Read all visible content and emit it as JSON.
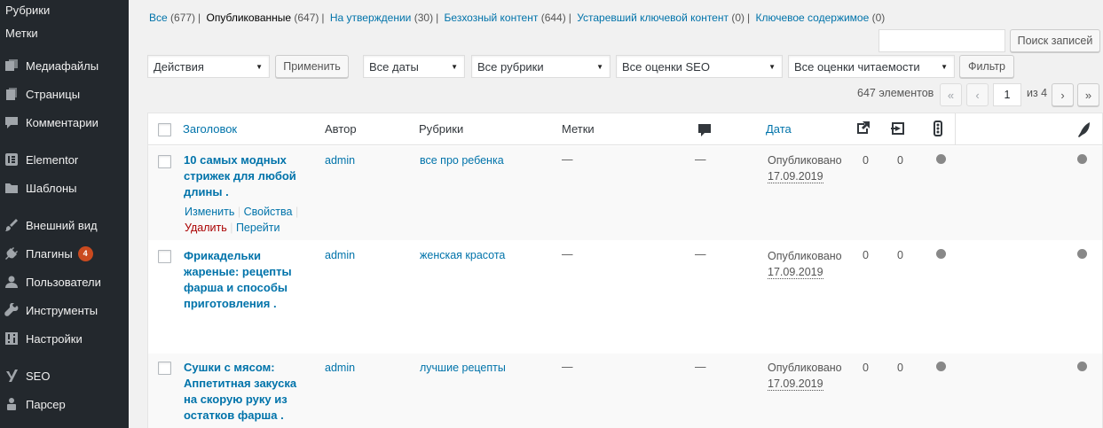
{
  "sidebar": {
    "sub_items": [
      "Рубрики",
      "Метки"
    ],
    "items": [
      {
        "label": "Медиафайлы",
        "icon": "media-icon"
      },
      {
        "label": "Страницы",
        "icon": "pages-icon"
      },
      {
        "label": "Комментарии",
        "icon": "comments-icon"
      },
      {
        "label": "Elementor",
        "icon": "elementor-icon"
      },
      {
        "label": "Шаблоны",
        "icon": "folder-icon"
      },
      {
        "label": "Внешний вид",
        "icon": "appearance-icon"
      },
      {
        "label": "Плагины",
        "icon": "plugins-icon",
        "badge": "4"
      },
      {
        "label": "Пользователи",
        "icon": "users-icon"
      },
      {
        "label": "Инструменты",
        "icon": "tools-icon"
      },
      {
        "label": "Настройки",
        "icon": "settings-icon"
      },
      {
        "label": "SEO",
        "icon": "yoast-icon"
      },
      {
        "label": "Парсер",
        "icon": "parser-icon"
      }
    ]
  },
  "status": {
    "all": {
      "label": "Все",
      "count": "(677)"
    },
    "published": {
      "label": "Опубликованные",
      "count": "(647)"
    },
    "pending": {
      "label": "На утверждении",
      "count": "(30)"
    },
    "orphan": {
      "label": "Безхозный контент",
      "count": "(644)"
    },
    "stale": {
      "label": "Устаревший ключевой контент",
      "count": "(0)"
    },
    "cornerstone": {
      "label": "Ключевое содержимое",
      "count": "(0)"
    }
  },
  "search": {
    "value": "",
    "button": "Поиск записей"
  },
  "toolbar": {
    "bulk_action": "Действия",
    "apply": "Применить",
    "dates": "Все даты",
    "categories": "Все рубрики",
    "seo": "Все оценки SEO",
    "readability": "Все оценки читаемости",
    "filter": "Фильтр"
  },
  "pagination": {
    "count": "647 элементов",
    "first": "«",
    "prev": "‹",
    "current": "1",
    "of": "из 4",
    "next": "›",
    "last": "»"
  },
  "columns": {
    "title": "Заголовок",
    "author": "Автор",
    "categories": "Рубрики",
    "tags": "Метки",
    "date": "Дата"
  },
  "rows": [
    {
      "title": "10 самых модных стрижек для любой длины .",
      "author": "admin",
      "category": "все про ребенка",
      "tags": "—",
      "comments": "—",
      "status": "Опубликовано",
      "date": "17.09.2019",
      "links_out": "0",
      "links_in": "0",
      "actions": {
        "edit": "Изменить",
        "quick": "Свойства",
        "delete": "Удалить",
        "view": "Перейти"
      }
    },
    {
      "title": "Фрикадельки жареные: рецепты фарша и способы приготовления .",
      "author": "admin",
      "category": "женская красота",
      "tags": "—",
      "comments": "—",
      "status": "Опубликовано",
      "date": "17.09.2019",
      "links_out": "0",
      "links_in": "0"
    },
    {
      "title": "Сушки с мясом: Аппетитная закуска на скорую руку из остатков фарша .",
      "author": "admin",
      "category": "лучшие рецепты",
      "tags": "—",
      "comments": "—",
      "status": "Опубликовано",
      "date": "17.09.2019",
      "links_out": "0",
      "links_in": "0"
    }
  ]
}
